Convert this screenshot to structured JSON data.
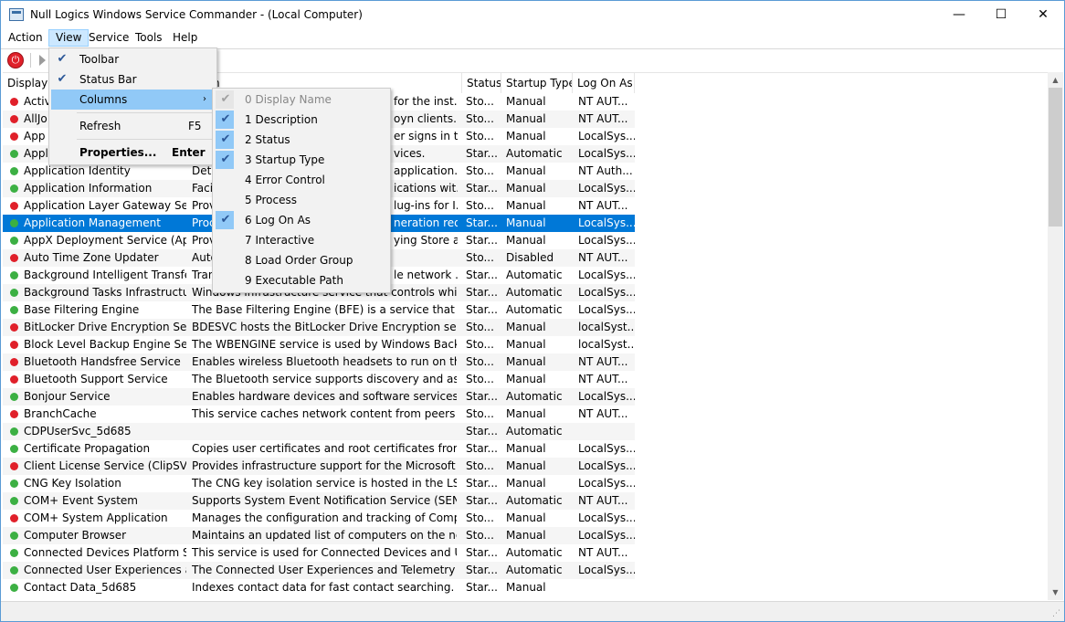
{
  "window": {
    "title": "Null Logics Windows Service Commander - (Local Computer)",
    "min": "—",
    "max": "☐",
    "close": "✕"
  },
  "menubar": [
    "Action",
    "View",
    "Service",
    "Tools",
    "Help"
  ],
  "view_menu": {
    "items": [
      {
        "label": "Toolbar",
        "checked": true
      },
      {
        "label": "Status Bar",
        "checked": true
      },
      {
        "label": "Columns",
        "submenu": true
      },
      {
        "label": "Refresh",
        "accel": "F5"
      },
      {
        "label": "Properties...",
        "accel": "Enter",
        "bold": true
      }
    ]
  },
  "columns_menu": {
    "items": [
      {
        "label": "0 Display Name",
        "checked": true,
        "disabled": true
      },
      {
        "label": "1 Description",
        "checked": true
      },
      {
        "label": "2 Status",
        "checked": true
      },
      {
        "label": "3 Startup Type",
        "checked": true
      },
      {
        "label": "4 Error Control",
        "checked": false
      },
      {
        "label": "5 Process",
        "checked": false
      },
      {
        "label": "6 Log On As",
        "checked": true
      },
      {
        "label": "7 Interactive",
        "checked": false
      },
      {
        "label": "8 Load Order Group",
        "checked": false
      },
      {
        "label": "9 Executable Path",
        "checked": false
      }
    ]
  },
  "columns": [
    "Display",
    "ption",
    "Status",
    "Startup Type",
    "Log On As"
  ],
  "colors": {
    "running": "#3cb043",
    "stopped": "#e0202a",
    "selected": "#0078d7"
  },
  "rows": [
    {
      "name": "Activ",
      "desc": "for the inst...",
      "status": "Sto...",
      "startup": "Manual",
      "logon": "NT AUT...",
      "state": "stopped"
    },
    {
      "name": "AllJo",
      "desc": "oyn clients...",
      "status": "Sto...",
      "startup": "Manual",
      "logon": "NT AUT...",
      "state": "stopped"
    },
    {
      "name": "App",
      "desc": "er signs in t...",
      "status": "Sto...",
      "startup": "Manual",
      "logon": "LocalSys...",
      "state": "stopped"
    },
    {
      "name": "Appl",
      "desc": "vices.",
      "status": "Star...",
      "startup": "Automatic",
      "logon": "LocalSys...",
      "state": "running"
    },
    {
      "name": "Application Identity",
      "desc": "Dete",
      "desc2": "application...",
      "status": "Sto...",
      "startup": "Manual",
      "logon": "NT Auth...",
      "state": "running"
    },
    {
      "name": "Application Information",
      "desc": "Facil",
      "desc2": "ications wit...",
      "status": "Star...",
      "startup": "Manual",
      "logon": "LocalSys...",
      "state": "running"
    },
    {
      "name": "Application Layer Gateway Serv...",
      "desc": "Prov",
      "desc2": "lug-ins for I...",
      "status": "Sto...",
      "startup": "Manual",
      "logon": "NT AUT...",
      "state": "stopped"
    },
    {
      "name": "Application Management",
      "desc": "Proc",
      "desc2": "neration req...",
      "status": "Star...",
      "startup": "Manual",
      "logon": "LocalSys...",
      "state": "running",
      "selected": true
    },
    {
      "name": "AppX Deployment Service (App...",
      "desc": "Prov",
      "desc2": "ying Store a...",
      "status": "Star...",
      "startup": "Manual",
      "logon": "LocalSys...",
      "state": "running"
    },
    {
      "name": "Auto Time Zone Updater",
      "desc": "Auto",
      "desc2": "",
      "status": "Sto...",
      "startup": "Disabled",
      "logon": "NT AUT...",
      "state": "stopped"
    },
    {
      "name": "Background Intelligent Transfer...",
      "desc": "Tran",
      "desc2": "le network ...",
      "status": "Star...",
      "startup": "Automatic",
      "logon": "LocalSys...",
      "state": "running"
    },
    {
      "name": "Background Tasks Infrastructur...",
      "desc": "Windows infrastructure service that controls which b...",
      "status": "Star...",
      "startup": "Automatic",
      "logon": "LocalSys...",
      "state": "running"
    },
    {
      "name": "Base Filtering Engine",
      "desc": "The Base Filtering Engine (BFE) is a service that mana...",
      "status": "Star...",
      "startup": "Automatic",
      "logon": "LocalSys...",
      "state": "running"
    },
    {
      "name": "BitLocker Drive Encryption Servi...",
      "desc": "BDESVC hosts the BitLocker Drive Encryption service....",
      "status": "Sto...",
      "startup": "Manual",
      "logon": "localSyst...",
      "state": "stopped"
    },
    {
      "name": "Block Level Backup Engine Serv...",
      "desc": "The WBENGINE service is used by Windows Backup t...",
      "status": "Sto...",
      "startup": "Manual",
      "logon": "localSyst...",
      "state": "stopped"
    },
    {
      "name": "Bluetooth Handsfree Service",
      "desc": "Enables wireless Bluetooth headsets to run on this co...",
      "status": "Sto...",
      "startup": "Manual",
      "logon": "NT AUT...",
      "state": "stopped"
    },
    {
      "name": "Bluetooth Support Service",
      "desc": "The Bluetooth service supports discovery and associ...",
      "status": "Sto...",
      "startup": "Manual",
      "logon": "NT AUT...",
      "state": "stopped"
    },
    {
      "name": "Bonjour Service",
      "desc": "Enables hardware devices and software services to au...",
      "status": "Star...",
      "startup": "Automatic",
      "logon": "LocalSys...",
      "state": "running"
    },
    {
      "name": "BranchCache",
      "desc": "This service caches network content from peers on t...",
      "status": "Sto...",
      "startup": "Manual",
      "logon": "NT AUT...",
      "state": "stopped"
    },
    {
      "name": "CDPUserSvc_5d685",
      "desc": "",
      "status": "Star...",
      "startup": "Automatic",
      "logon": "",
      "state": "running"
    },
    {
      "name": "Certificate Propagation",
      "desc": "Copies user certificates and root certificates from sm...",
      "status": "Star...",
      "startup": "Manual",
      "logon": "LocalSys...",
      "state": "running"
    },
    {
      "name": "Client License Service (ClipSVC)",
      "desc": "Provides infrastructure support for the Microsoft Stor...",
      "status": "Sto...",
      "startup": "Manual",
      "logon": "LocalSys...",
      "state": "stopped"
    },
    {
      "name": "CNG Key Isolation",
      "desc": "The CNG key isolation service is hosted in the LSA pr...",
      "status": "Star...",
      "startup": "Manual",
      "logon": "LocalSys...",
      "state": "running"
    },
    {
      "name": "COM+ Event System",
      "desc": "Supports System Event Notification Service (SENS), w...",
      "status": "Star...",
      "startup": "Automatic",
      "logon": "NT AUT...",
      "state": "running"
    },
    {
      "name": "COM+ System Application",
      "desc": "Manages the configuration and tracking of Compon...",
      "status": "Sto...",
      "startup": "Manual",
      "logon": "LocalSys...",
      "state": "stopped"
    },
    {
      "name": "Computer Browser",
      "desc": "Maintains an updated list of computers on the netw...",
      "status": "Sto...",
      "startup": "Manual",
      "logon": "LocalSys...",
      "state": "running"
    },
    {
      "name": "Connected Devices Platform Se...",
      "desc": "This service is used for Connected Devices and Unive...",
      "status": "Star...",
      "startup": "Automatic",
      "logon": "NT AUT...",
      "state": "running"
    },
    {
      "name": "Connected User Experiences an...",
      "desc": "The Connected User Experiences and Telemetry servi...",
      "status": "Star...",
      "startup": "Automatic",
      "logon": "LocalSys...",
      "state": "running"
    },
    {
      "name": "Contact Data_5d685",
      "desc": "Indexes contact data for fast contact searching. If yo...",
      "status": "Star...",
      "startup": "Manual",
      "logon": "",
      "state": "running"
    }
  ]
}
